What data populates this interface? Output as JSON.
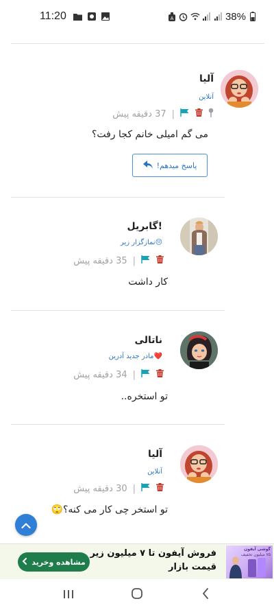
{
  "status_bar": {
    "time": "11:20",
    "battery": "38%",
    "left_icons": [
      "folder-icon",
      "record-icon",
      "gallery-icon"
    ],
    "right_icons": [
      "alarm-icon",
      "clock-icon",
      "wifi-icon",
      "signal-icon",
      "signal-icon",
      "battery-icon"
    ]
  },
  "comments": [
    {
      "name": "آلیا",
      "subline": "آنلاین",
      "time": "37 دقیقه پیش",
      "message": "می گم امیلی خانم کجا رفت؟",
      "has_pin": true,
      "reply_label": "پاسخ میدهم!"
    },
    {
      "name": "گابریل!",
      "subline": "نمازگزار زیر😔",
      "time": "35 دقیقه پیش",
      "message": "کار داشت"
    },
    {
      "name": "ناتالی",
      "subline": "مادر جدید آدرین❤️",
      "time": "34 دقیقه پیش",
      "message": "تو استخره.."
    },
    {
      "name": "آلیا",
      "subline": "آنلاین",
      "time": "30 دقیقه پیش",
      "message": "تو استخر چی کار می کنه؟🙄"
    }
  ],
  "ad": {
    "title": "فروش آیفون تا ۷ میلیون زیر",
    "subtitle": "قیمت بازار",
    "button": "مشاهده وخرید",
    "image_line1": "گوشی آیفون",
    "image_line2": "۷۵ میلیون تخفیف"
  },
  "colors": {
    "link_blue": "#2a73c7",
    "flag_teal": "#17a2b8",
    "trash_red": "#c0392b",
    "ad_green": "#1e7d4a",
    "fab_blue": "#2f7fd6"
  }
}
